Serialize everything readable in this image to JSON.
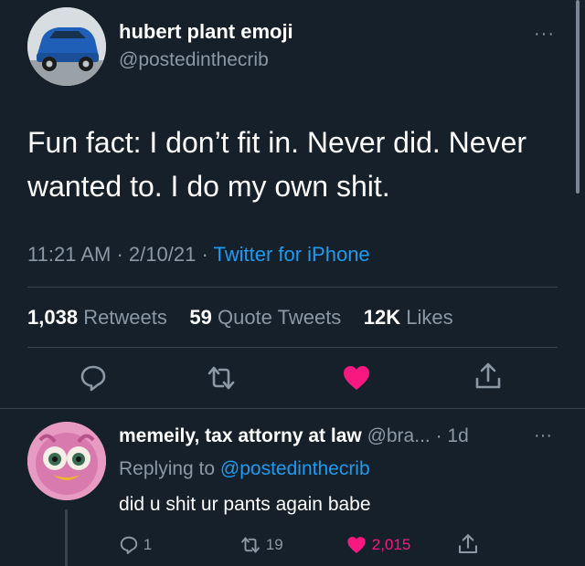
{
  "tweet": {
    "author_name": "hubert plant emoji",
    "author_handle": "@postedinthecrib",
    "text": "Fun fact: I don’t fit in. Never did. Never wanted to. I do my own shit.",
    "time": "11:21 AM",
    "date": "2/10/21",
    "source": "Twitter for iPhone",
    "more_label": "···",
    "stats": {
      "retweets_count": "1,038",
      "retweets_label": "Retweets",
      "quotes_count": "59",
      "quotes_label": "Quote Tweets",
      "likes_count": "12K",
      "likes_label": "Likes"
    },
    "actions": [
      "reply-icon",
      "retweet-icon",
      "like-icon",
      "share-icon"
    ],
    "liked": true
  },
  "reply": {
    "author_name": "memeily, tax attorny at law",
    "author_handle": "@bra...",
    "time_ago": "1d",
    "more_label": "···",
    "replying_prefix": "Replying to",
    "replying_to": "@postedinthecrib",
    "text": "did u shit ur pants again babe",
    "reply_count": "1",
    "retweet_count": "19",
    "like_count": "2,015",
    "liked": true
  },
  "colors": {
    "background": "#15202b",
    "text": "#ffffff",
    "muted": "#8b98a5",
    "accent": "#1d9bf0",
    "like": "#f91880",
    "divider": "#38444d"
  }
}
